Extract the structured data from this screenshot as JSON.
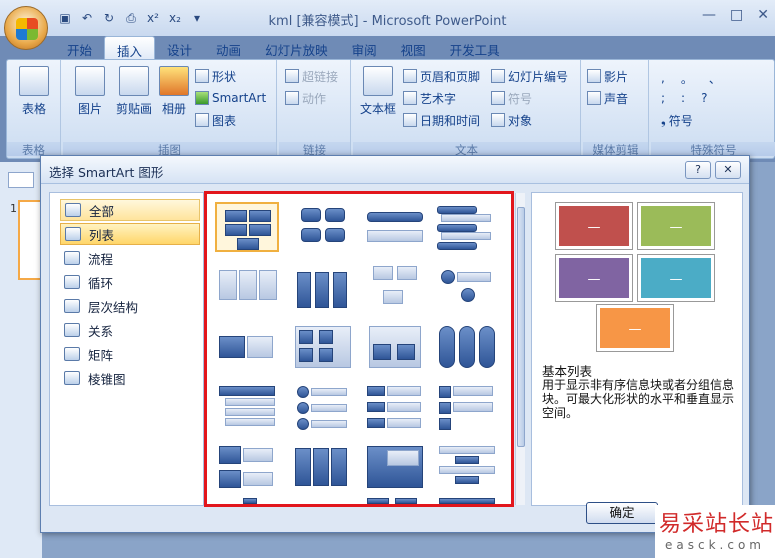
{
  "window": {
    "title": "kml [兼容模式] - Microsoft PowerPoint",
    "qat_icons": [
      "save-icon",
      "undo-icon",
      "redo-icon",
      "print-preview-icon",
      "superscript-icon",
      "subscript-icon",
      "customize-icon"
    ],
    "superscript": "x²",
    "subscript": "x₂",
    "controls": [
      "—",
      "□",
      "✕"
    ]
  },
  "tabs": [
    {
      "label": "开始",
      "active": false
    },
    {
      "label": "插入",
      "active": true
    },
    {
      "label": "设计",
      "active": false
    },
    {
      "label": "动画",
      "active": false
    },
    {
      "label": "幻灯片放映",
      "active": false
    },
    {
      "label": "审阅",
      "active": false
    },
    {
      "label": "视图",
      "active": false
    },
    {
      "label": "开发工具",
      "active": false
    }
  ],
  "ribbon": {
    "table_group": {
      "label": "表格",
      "button": "表格"
    },
    "illustrations": {
      "label": "插图",
      "picture": "图片",
      "clipart": "剪贴画",
      "album": "相册",
      "shapes": "形状",
      "smartart": "SmartArt",
      "chart": "图表"
    },
    "links": {
      "label": "链接",
      "hyperlink": "超链接",
      "action": "动作"
    },
    "text": {
      "label": "文本",
      "textbox": "文本框",
      "header_footer": "页眉和页脚",
      "wordart": "艺术字",
      "datetime": "日期和时间",
      "slide_number": "幻灯片编号",
      "symbol": "符号",
      "object": "对象"
    },
    "media": {
      "label": "媒体剪辑",
      "movie": "影片",
      "sound": "声音"
    },
    "special": {
      "label": "特殊符号",
      "symbols": [
        ",",
        "。",
        "、",
        ";",
        ":",
        "?"
      ],
      "more": "符号"
    }
  },
  "slide_panel": {
    "slide_number": "1"
  },
  "dialog": {
    "title": "选择 SmartArt 图形",
    "help": "?",
    "close": "✕",
    "categories": [
      {
        "label": "全部",
        "state": "hover"
      },
      {
        "label": "列表",
        "state": "active"
      },
      {
        "label": "流程",
        "state": ""
      },
      {
        "label": "循环",
        "state": ""
      },
      {
        "label": "层次结构",
        "state": ""
      },
      {
        "label": "关系",
        "state": ""
      },
      {
        "label": "矩阵",
        "state": ""
      },
      {
        "label": "棱锥图",
        "state": ""
      }
    ],
    "preview": {
      "title": "基本列表",
      "description": "用于显示非有序信息块或者分组信息块。可最大化形状的水平和垂直显示空间。",
      "colors": [
        "#c0504d",
        "#9bbb59",
        "#8064a2",
        "#4bacc6",
        "#f79646"
      ],
      "dash": "—"
    },
    "ok_label": "确定"
  },
  "watermark": {
    "line1": "易采站长站",
    "line2": "easck.com"
  }
}
